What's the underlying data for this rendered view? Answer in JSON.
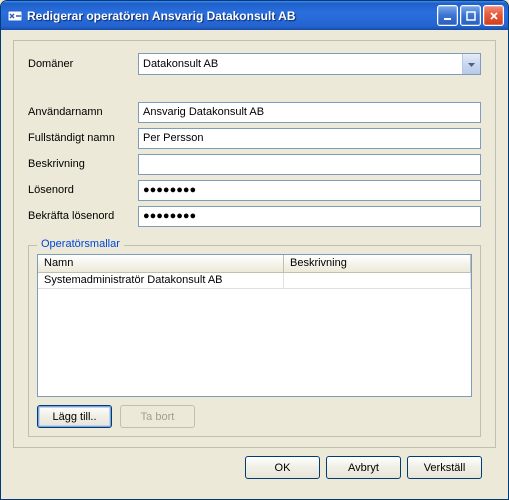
{
  "window": {
    "title": "Redigerar operatören Ansvarig Datakonsult AB"
  },
  "form": {
    "domains_label": "Domäner",
    "domains_value": "Datakonsult AB",
    "username_label": "Användarnamn",
    "username_value": "Ansvarig Datakonsult AB",
    "fullname_label": "Fullständigt namn",
    "fullname_value": "Per Persson",
    "description_label": "Beskrivning",
    "description_value": "",
    "password_label": "Lösenord",
    "password_value": "●●●●●●●●",
    "confirm_label": "Bekräfta lösenord",
    "confirm_value": "●●●●●●●●"
  },
  "group": {
    "title": "Operatörsmallar",
    "columns": {
      "col1": "Namn",
      "col2": "Beskrivning"
    },
    "rows": [
      {
        "name": "Systemadministratör Datakonsult AB",
        "desc": ""
      }
    ],
    "add_label": "Lägg till..",
    "remove_label": "Ta bort"
  },
  "footer": {
    "ok": "OK",
    "cancel": "Avbryt",
    "apply": "Verkställ"
  }
}
